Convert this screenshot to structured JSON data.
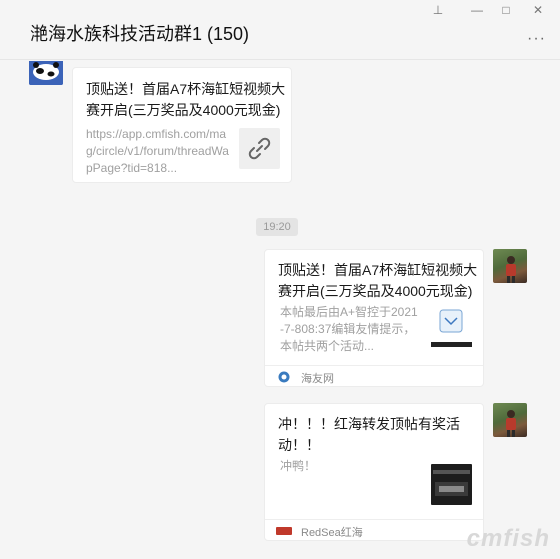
{
  "window": {
    "title": "滟海水族科技活动群1 (150)",
    "controls": {
      "pin": "⊥",
      "minimize": "—",
      "maximize": "□",
      "close": "✕"
    },
    "more_icon": "···"
  },
  "messages": [
    {
      "side": "left",
      "title": "顶贴送！首届A7杯海缸短视频大赛开启(三万奖品及4000元现金)",
      "description": "https://app.cmfish.com/mag/circle/v1/forum/threadWapPage?tid=818...",
      "thumb_icon": "link-icon"
    },
    {
      "timestamp": "19:20"
    },
    {
      "side": "right",
      "title": "顶贴送！首届A7杯海缸短视频大赛开启(三万奖品及4000元现金)",
      "description": "本帖最后由A+智控于2021-7-808:37编辑友情提示，本帖共两个活动...",
      "source": "海友网"
    },
    {
      "side": "right",
      "title": "冲！！！红海转发顶帖有奖活动！！",
      "description": "冲鸭！",
      "source": "RedSea红海",
      "source_logo": "RedSea"
    }
  ],
  "watermark": "cmfish"
}
